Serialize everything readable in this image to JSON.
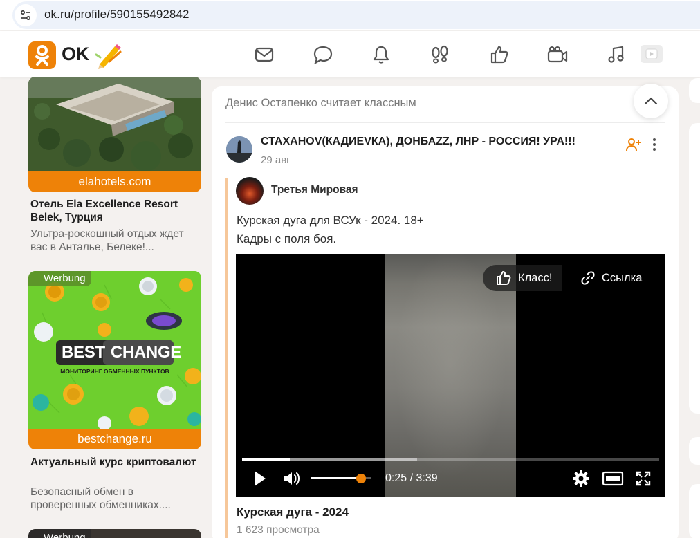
{
  "browser": {
    "url": "ok.ru/profile/590155492842"
  },
  "header": {
    "logo_text": "OK",
    "nav_icons": [
      "mail-icon",
      "chat-icon",
      "bell-icon",
      "guests-icon",
      "like-icon",
      "camera-icon",
      "music-icon",
      "video-icon"
    ]
  },
  "ads": [
    {
      "domain": "elahotels.com",
      "title": "Отель Ela Excellence Resort Belek, Турция",
      "desc": "Ультра-роскошный отдых ждет вас в Анталье, Белеке!..."
    },
    {
      "badge": "Werbung",
      "brand_a": "BEST",
      "brand_b": "CHANGE",
      "brand_sub": "МОНИТОРИНГ ОБМЕННЫХ ПУНКТОВ",
      "domain": "bestchange.ru",
      "title": "Актуальный курс криптовалют",
      "desc": "Безопасный обмен в проверенных обменниках...."
    },
    {
      "badge": "Werbung"
    }
  ],
  "feed": {
    "activity": "Денис Остапенко считает классным",
    "group_name": "СТАХАНОV(КАДИЕVКА), ДОНБАZZ, ЛНР - РОССИЯ! УРА!!!",
    "date": "29 авг",
    "repost_author": "Третья Мировая",
    "text_line1": "Курская дуга для ВСУк - 2024. 18+",
    "text_line2": "Кадры с поля боя.",
    "video": {
      "like_label": "Класс!",
      "link_label": "Ссылка",
      "time": "0:25 / 3:39",
      "played_fraction": 0.114,
      "buffered_fraction": 0.42,
      "volume_fraction": 0.83
    },
    "video_title": "Курская дуга - 2024",
    "views": "1 623 просмотра"
  },
  "colors": {
    "brand_orange": "#ee8208",
    "ad_green": "#6ecf2e",
    "repost_bar": "#f6c79a"
  }
}
